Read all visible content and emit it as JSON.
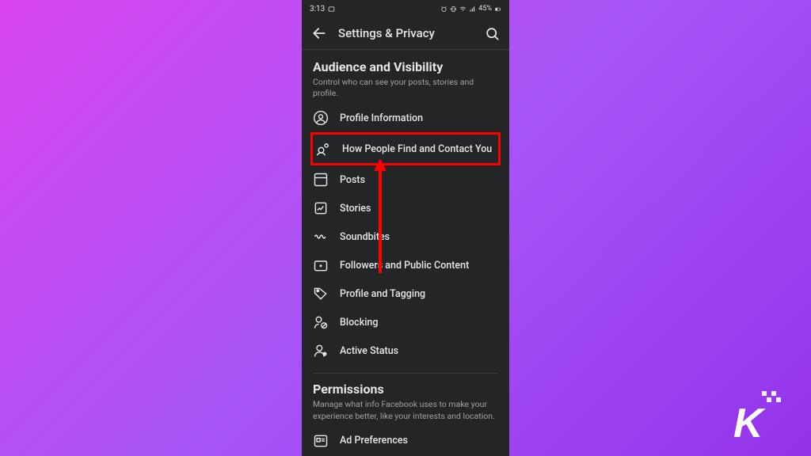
{
  "statusbar": {
    "time": "3:13",
    "battery_text": "45%"
  },
  "header": {
    "title": "Settings & Privacy"
  },
  "sections": [
    {
      "title": "Audience and Visibility",
      "desc": "Control who can see your posts, stories and profile.",
      "items": [
        {
          "label": "Profile Information"
        },
        {
          "label": "How People Find and Contact You"
        },
        {
          "label": "Posts"
        },
        {
          "label": "Stories"
        },
        {
          "label": "Soundbites"
        },
        {
          "label": "Followers and Public Content"
        },
        {
          "label": "Profile and Tagging"
        },
        {
          "label": "Blocking"
        },
        {
          "label": "Active Status"
        }
      ]
    },
    {
      "title": "Permissions",
      "desc": "Manage what info Facebook uses to make your experience better, like your interests and location.",
      "items": [
        {
          "label": "Ad Preferences"
        }
      ]
    }
  ]
}
